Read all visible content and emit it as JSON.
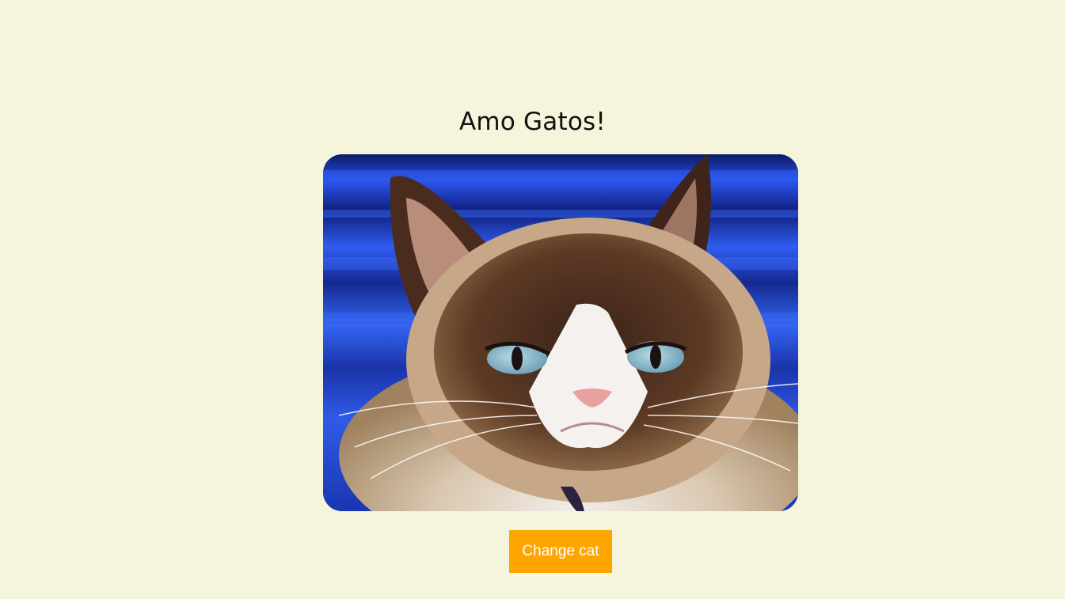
{
  "page": {
    "title": "Amo Gatos!",
    "background_color": "#f5f5dc"
  },
  "cat_image": {
    "icon": "grumpy-cat-photo"
  },
  "actions": {
    "change_cat_label": "Change cat",
    "button_color": "#ffa500"
  }
}
